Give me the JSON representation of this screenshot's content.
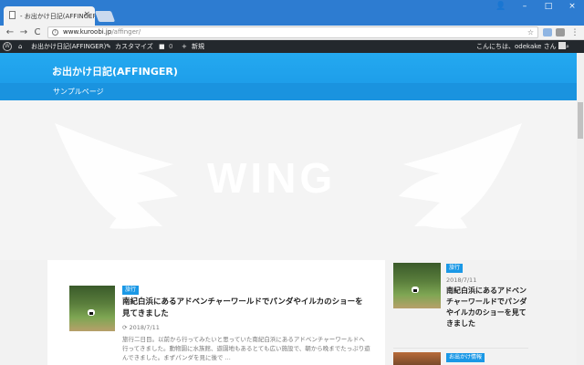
{
  "browser": {
    "tab_title": "- お出かけ日記(AFFINGER)",
    "close_glyph": "×",
    "url_host": "www.kuroobi.jp",
    "url_path": "/affinger/",
    "win_controls": [
      "👤",
      "–",
      "□",
      "×"
    ],
    "nav": {
      "back": "←",
      "forward": "→",
      "reload": "C"
    }
  },
  "adminbar": {
    "site_name": "お出かけ日記(AFFINGER)",
    "customize": "カスタマイズ",
    "comments_count": "0",
    "new": "新規",
    "greeting": "こんにちは、odekake さん"
  },
  "site": {
    "title": "お出かけ日記(AFFINGER)",
    "nav_item": "サンプルページ",
    "hero_wordmark": "WING"
  },
  "main_post": {
    "category": "旅行",
    "title": "南紀白浜にあるアドベンチャーワールドでパンダやイルカのショーを見てきました",
    "date": "2018/7/11",
    "excerpt": "旅行二日目。以前から行ってみたいと思っていた南紀白浜にあるアドベンチャーワールドへ行ってきました。動物園に水族館、遊園地もあるとても広い施設で、朝から晩までたっぷり遊んできました。まずパンダを見に後で ..."
  },
  "sidebar_posts": [
    {
      "category": "旅行",
      "date": "2018/7/11",
      "title": "南紀白浜にあるアドベンチャーワールドでパンダやイルカのショーを見てきました"
    },
    {
      "category": "お出かけ情報"
    }
  ],
  "colors": {
    "accent": "#1a98e6",
    "adminbar": "#23282d",
    "tabstrip": "#2d7cd1"
  }
}
